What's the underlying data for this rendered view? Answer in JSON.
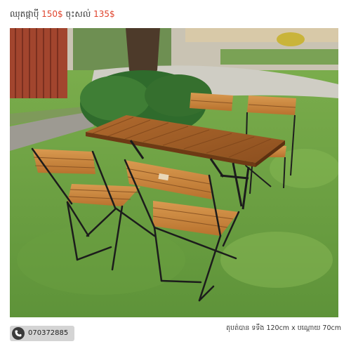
{
  "header": {
    "item_label": "ឈុតផ្កាប៉ី",
    "original_price": "150$",
    "sale_label": "ចុះសល់",
    "sale_price": "135$"
  },
  "photo": {
    "subject": "outdoor wooden slat table with four folding chairs on lawn"
  },
  "footer": {
    "phone_icon": "phone-icon",
    "phone": "070372885",
    "caption": "តុបត់បាន ទទឹង 120cm x បណ្ដោយ 70cm"
  },
  "colors": {
    "price_red": "#e0432c",
    "pill_gray": "#d4d4d4"
  }
}
